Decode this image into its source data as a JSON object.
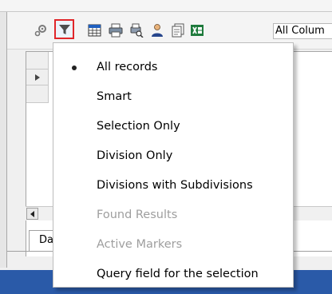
{
  "toolbar": {
    "column_select_value": "All Colum",
    "icons": [
      "settings-icon",
      "filter-icon",
      "calendar-grid-icon",
      "printer-icon",
      "print-preview-icon",
      "user-icon",
      "document-icon",
      "excel-icon"
    ]
  },
  "sheet_tab": {
    "label": "Da"
  },
  "filter_menu": {
    "items": [
      {
        "label": "All records",
        "selected": true,
        "enabled": true
      },
      {
        "label": "Smart",
        "selected": false,
        "enabled": true
      },
      {
        "label": "Selection Only",
        "selected": false,
        "enabled": true
      },
      {
        "label": "Division Only",
        "selected": false,
        "enabled": true
      },
      {
        "label": "Divisions with Subdivisions",
        "selected": false,
        "enabled": true
      },
      {
        "label": "Found Results",
        "selected": false,
        "enabled": false
      },
      {
        "label": "Active Markers",
        "selected": false,
        "enabled": false
      },
      {
        "label": "Query field for the selection",
        "selected": false,
        "enabled": true
      }
    ]
  },
  "colors": {
    "highlight_border": "#e0262a",
    "status_bar": "#2a5aa8",
    "disabled_text": "#9e9e9e"
  }
}
